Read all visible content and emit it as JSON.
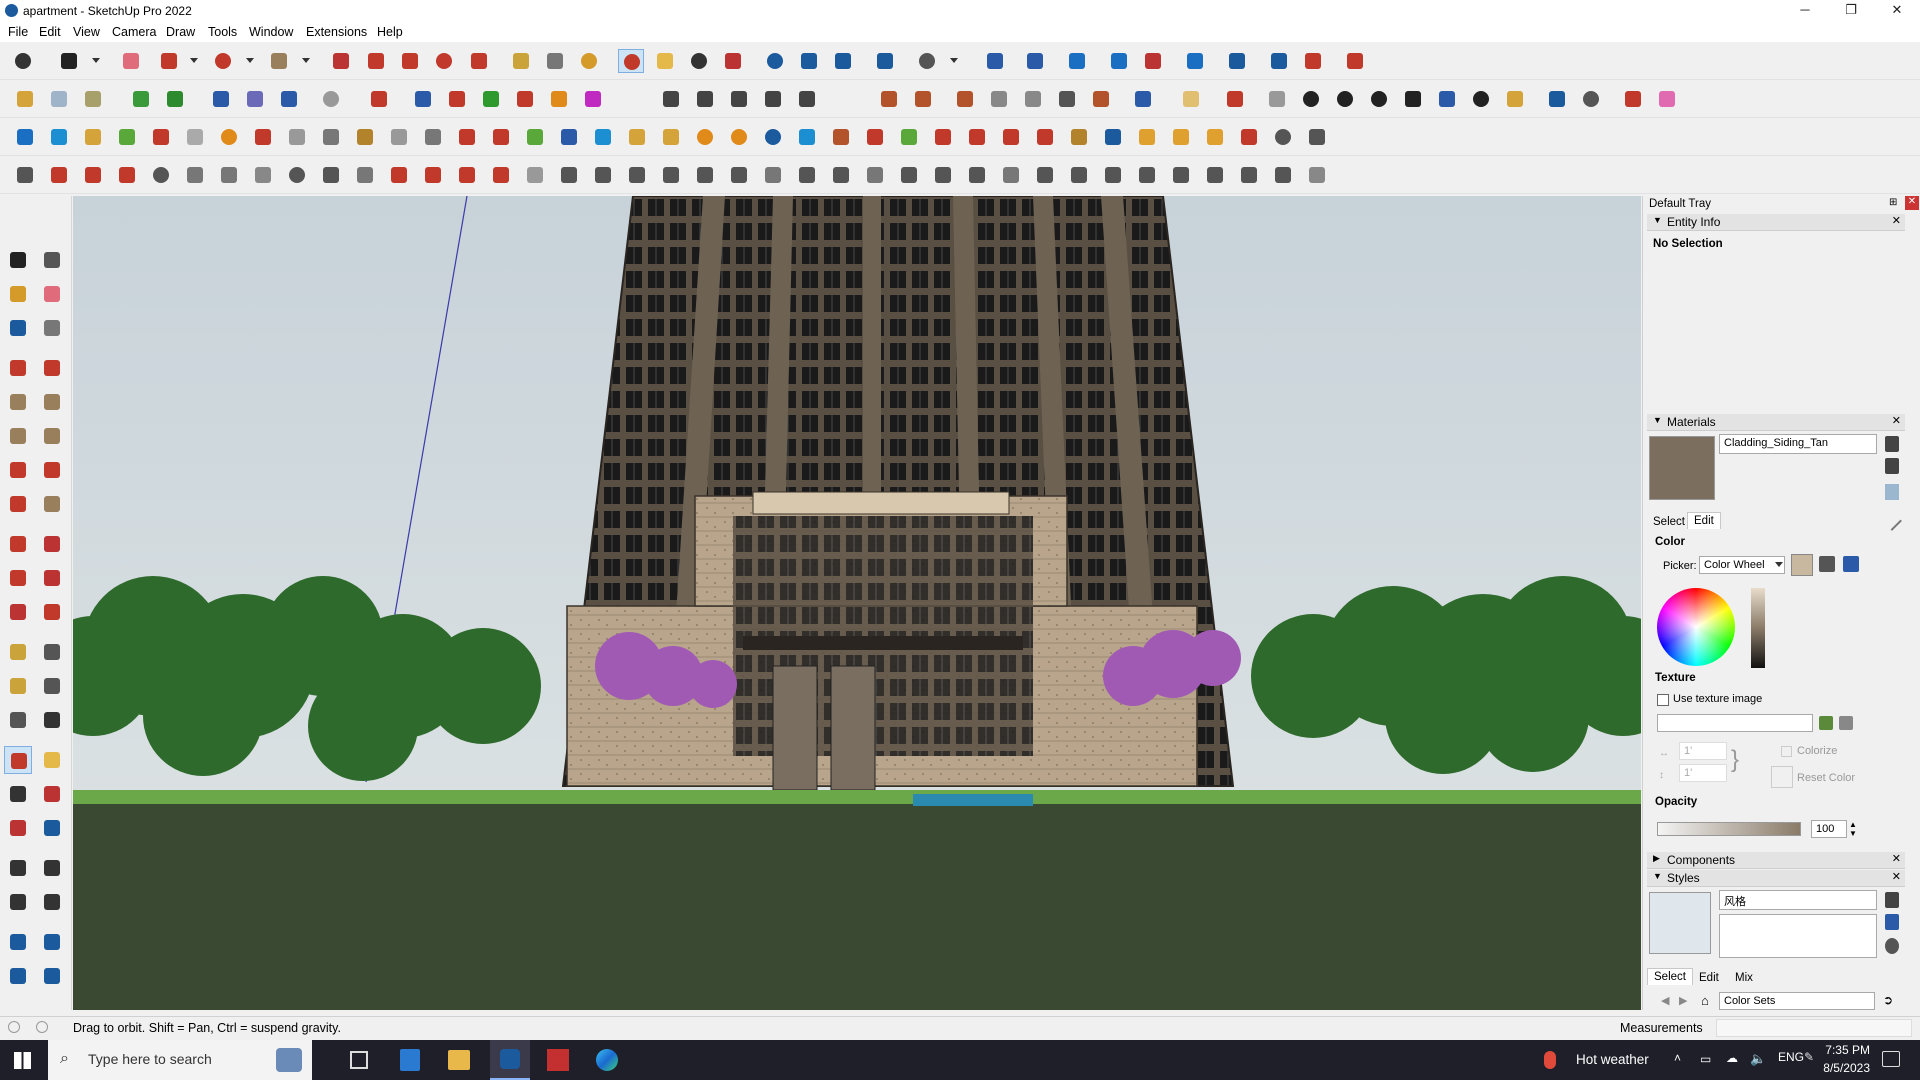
{
  "window": {
    "title": "apartment - SketchUp Pro 2022"
  },
  "window_controls": {
    "minimize": "─",
    "restore": "❐",
    "close": "✕"
  },
  "menu": [
    "File",
    "Edit",
    "View",
    "Camera",
    "Draw",
    "Tools",
    "Window",
    "Extensions",
    "Help"
  ],
  "colors": {
    "accent": "#cde4f7",
    "tray_header": "#e3e3e3",
    "material_swatch": "#7c6e5e",
    "flower": "#a05ab4",
    "tree": "#2e6a2c",
    "lawn": "#3a4a32"
  },
  "tray": {
    "title": "Default Tray",
    "pin": "⊞",
    "close": "✕",
    "entity_info": {
      "header": "Entity Info",
      "selection": "No Selection"
    },
    "materials": {
      "header": "Materials",
      "name": "Cladding_Siding_Tan",
      "tabs": [
        "Select",
        "Edit"
      ],
      "color_label": "Color",
      "picker_label": "Picker:",
      "picker_value": "Color Wheel",
      "texture_label": "Texture",
      "use_texture_label": "Use texture image",
      "width_value": "1'",
      "height_value": "1'",
      "colorize_label": "Colorize",
      "reset_color_label": "Reset Color",
      "opacity_label": "Opacity",
      "opacity_value": "100"
    },
    "components": {
      "header": "Components"
    },
    "styles": {
      "header": "Styles",
      "name": "风格",
      "tabs": [
        "Select",
        "Edit",
        "Mix"
      ],
      "collection": "Color Sets"
    }
  },
  "status": {
    "hint": "Drag to orbit. Shift = Pan, Ctrl = suspend gravity.",
    "measurements_label": "Measurements"
  },
  "taskbar": {
    "search_placeholder": "Type here to search",
    "weather": "Hot weather",
    "language": "ENG",
    "time": "7:35 PM",
    "date": "8/5/2023"
  }
}
